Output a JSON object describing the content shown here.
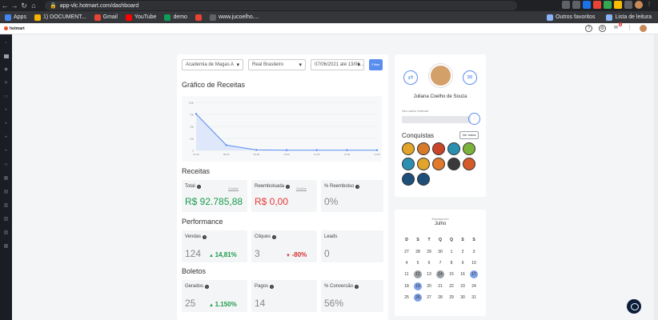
{
  "browser": {
    "url": "app-vlc.hotmart.com/dashboard",
    "bookmarks": [
      {
        "label": "Apps",
        "icon": "apps-grid-icon",
        "color": "#4285f4"
      },
      {
        "label": "1) DOCUMENT...",
        "icon": "doc-icon",
        "color": "#f4b400"
      },
      {
        "label": "Gmail",
        "icon": "gmail-icon",
        "color": "#ea4335"
      },
      {
        "label": "YouTube",
        "icon": "youtube-icon",
        "color": "#ff0000"
      },
      {
        "label": "demo",
        "icon": "demo-icon",
        "color": "#0f9d58"
      },
      {
        "label": "",
        "icon": "gmail-m-icon",
        "color": "#ea4335"
      },
      {
        "label": "www.jucoelho....",
        "icon": "globe-icon",
        "color": "#5f6368"
      }
    ],
    "bookmarks_right": [
      "Outros favoritos",
      "Lista de leitura"
    ]
  },
  "app": {
    "logo": "hotmart",
    "notification_count": "3"
  },
  "filters": {
    "product": "Academia de Magas A",
    "currency": "Real Brasileiro",
    "date_range": "07/06/2021 até 13/06...",
    "button": "Filtrar"
  },
  "revenue_chart_title": "Gráfico de Receitas",
  "chart_data": {
    "type": "area",
    "x": [
      "07-06",
      "08-06",
      "09-06",
      "10-06",
      "11-06",
      "12-06",
      "13-06"
    ],
    "values": [
      76000,
      11000,
      1000,
      500,
      500,
      500,
      500
    ],
    "ylim": [
      0,
      100000
    ],
    "yticks": [
      "0",
      "25k",
      "50k",
      "75k",
      "100k"
    ],
    "color": "#5b8def"
  },
  "receitas": {
    "title": "Receitas",
    "total_label": "Total",
    "total_value": "R$ 92.785,88",
    "total_hide": "Ocultar",
    "reembolsada_label": "Reembolsada",
    "reembolsada_value": "R$ 0,00",
    "reembolsada_hide": "Ocultar",
    "pct_reembolso_label": "% Reembolso",
    "pct_reembolso_value": "0%"
  },
  "performance": {
    "title": "Performance",
    "vendas_label": "Vendas",
    "vendas_value": "124",
    "vendas_change": "14,81%",
    "cliques_label": "Cliques",
    "cliques_value": "3",
    "cliques_change": "-80%",
    "leads_label": "Leads",
    "leads_value": "0"
  },
  "boletos": {
    "title": "Boletos",
    "gerados_label": "Gerados",
    "gerados_value": "25",
    "gerados_change": "1.150%",
    "pagos_label": "Pagos",
    "pagos_value": "14",
    "conversao_label": "% Conversão",
    "conversao_value": "56%"
  },
  "profile": {
    "name": "Juliana Coelho de Souza",
    "balance_label": "Seu saldo Hotmart",
    "achievements_title": "Conquistas",
    "see_all": "Ver todas",
    "badge_colors": [
      "#e2a52a",
      "#d77a2a",
      "#c9452a",
      "#2a8fb0",
      "#7bb33a",
      "#2a8fb0",
      "#e2a52a",
      "#e07a2a",
      "#3a3a3a",
      "#d45a2a",
      "#1e4e7a",
      "#1e4e7a"
    ]
  },
  "calendar": {
    "title": "Eventos em",
    "month": "Julho",
    "weekdays": [
      "D",
      "S",
      "T",
      "Q",
      "Q",
      "S",
      "S"
    ],
    "weeks": [
      [
        "27",
        "28",
        "29",
        "30",
        "1",
        "2",
        "3"
      ],
      [
        "4",
        "5",
        "6",
        "7",
        "8",
        "9",
        "10"
      ],
      [
        "11",
        "12",
        "13",
        "14",
        "15",
        "16",
        "17"
      ],
      [
        "18",
        "19",
        "20",
        "21",
        "22",
        "23",
        "24"
      ],
      [
        "25",
        "26",
        "27",
        "28",
        "29",
        "30",
        "31"
      ]
    ],
    "marked": {
      "12": "gray",
      "14": "gray",
      "17": "blue",
      "19": "blue",
      "26": "blue"
    }
  }
}
